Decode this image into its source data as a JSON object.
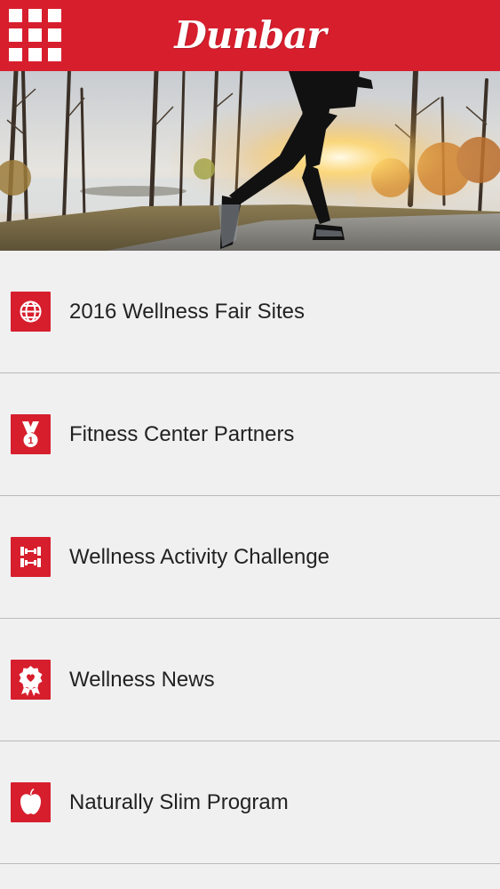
{
  "header": {
    "brand": "Dunbar",
    "menu_icon": "grid-menu-icon",
    "background_color": "#d71e2d"
  },
  "hero": {
    "image": "runner-autumn-trees-sunrise"
  },
  "menu": {
    "items": [
      {
        "label": "2016 Wellness Fair Sites",
        "icon": "globe-icon"
      },
      {
        "label": "Fitness Center Partners",
        "icon": "medal-icon"
      },
      {
        "label": "Wellness Activity Challenge",
        "icon": "dumbbell-icon"
      },
      {
        "label": "Wellness News",
        "icon": "award-ribbon-icon"
      },
      {
        "label": "Naturally Slim Program",
        "icon": "apple-icon"
      }
    ]
  },
  "colors": {
    "accent": "#d71e2d",
    "list_background": "#f0f0f0",
    "divider": "#b9b9b9",
    "text": "#222222"
  }
}
